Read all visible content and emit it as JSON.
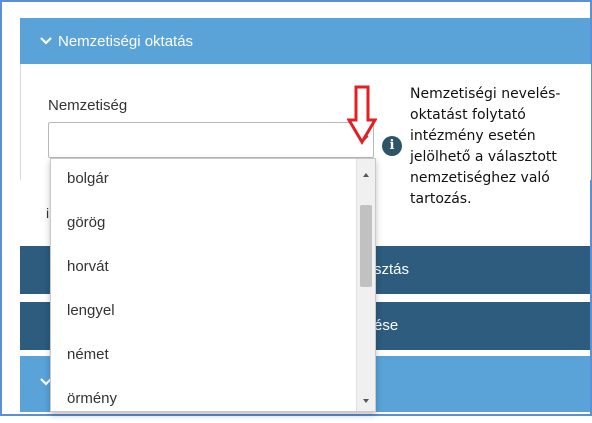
{
  "section": {
    "title": "Nemzetiségi oktatás",
    "chevron": "chevron-down-icon"
  },
  "field": {
    "label": "Nemzetiség",
    "selected": ""
  },
  "info": {
    "icon": "info-icon",
    "glyph": "i",
    "lines": [
      "Nemzetiségi nevelés-",
      "oktatást folytató",
      "intézmény esetén",
      "jelölhető a választott",
      "nemzetiséghez való",
      "tartozás."
    ]
  },
  "dropdown": {
    "options": [
      "bolgár",
      "görög",
      "horvát",
      "lengyel",
      "német",
      "örmény"
    ]
  },
  "partial": {
    "under_mark": "i",
    "bar1_text": "sztás",
    "bar2_text": "ése",
    "bar3_chevron": "✓"
  },
  "colors": {
    "header_blue": "#5aa3d8",
    "dark_bar": "#2d5c7e",
    "arrow_red": "#e31e24",
    "info_icon_bg": "#2e5566"
  }
}
